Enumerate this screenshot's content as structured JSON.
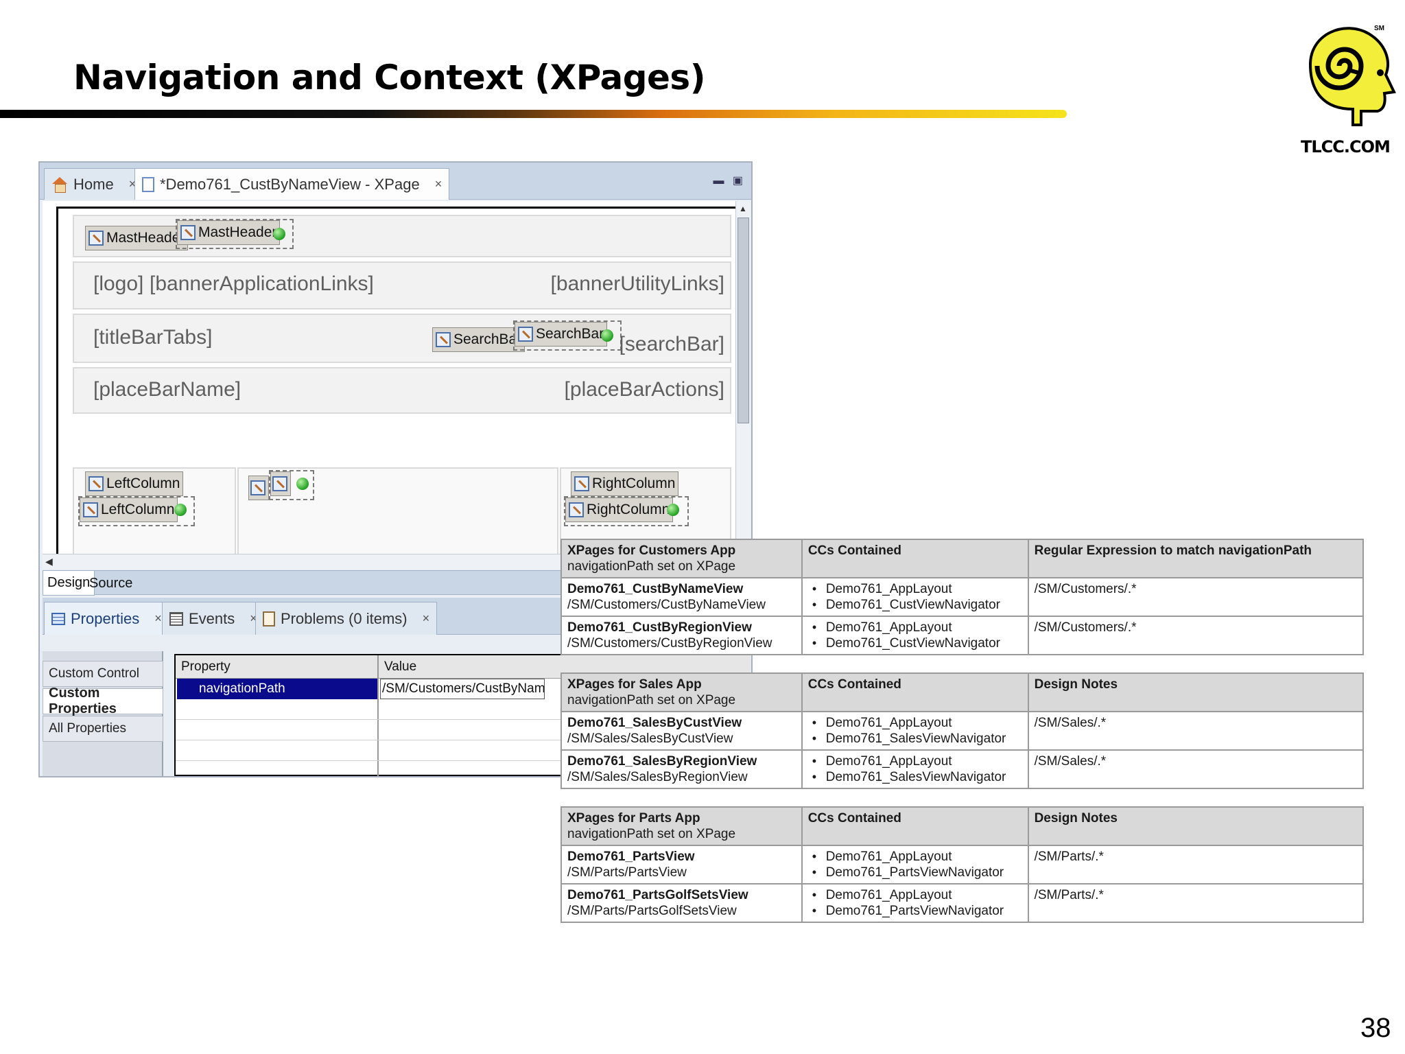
{
  "slide": {
    "title": "Navigation and Context (XPages)",
    "page_number": "38"
  },
  "logo": {
    "text": "TLCC.COM",
    "sm": "SM",
    "icon": "tlcc-spiral-head-icon"
  },
  "ide": {
    "editor_tabs": [
      {
        "label": "Home",
        "icon": "home-icon"
      },
      {
        "label": "*Demo761_CustByNameView - XPage",
        "icon": "xpage-icon"
      }
    ],
    "close_glyph": "×",
    "controls": {
      "mastheader_ref": "MastHeader",
      "mastheader_inst": "MastHeader",
      "searchbar_ref": "SearchBar",
      "searchbar_inst": "SearchBar",
      "leftcol_ref": "LeftColumn",
      "leftcol_inst": "LeftColumn",
      "rightcol_ref": "RightColumn",
      "rightcol_inst": "RightColumn"
    },
    "placeholders": {
      "logo": "[logo]",
      "banner_app_links": "[bannerApplicationLinks]",
      "banner_utility_links": "[bannerUtilityLinks]",
      "title_bar_tabs": "[titleBarTabs]",
      "search_bar": "[searchBar]",
      "place_bar_name": "[placeBarName]",
      "place_bar_actions": "[placeBarActions]"
    },
    "design_tabs": [
      "Design",
      "Source"
    ],
    "view_tabs": [
      {
        "label": "Properties",
        "icon": "properties-grid-icon"
      },
      {
        "label": "Events",
        "icon": "events-icon"
      },
      {
        "label": "Problems (0 items)",
        "icon": "problems-icon"
      }
    ],
    "side_nav": [
      "Custom Control",
      "Custom Properties",
      "All Properties"
    ],
    "prop_table": {
      "col_property": "Property",
      "col_value": "Value",
      "selected_property": "navigationPath",
      "selected_value": "/SM/Customers/CustByNameView"
    }
  },
  "tables": [
    {
      "headers": {
        "col1_title": "XPages for Customers App",
        "col1_sub": "navigationPath set on XPage",
        "col2": "CCs Contained",
        "col3": "Regular Expression to match navigationPath"
      },
      "rows": [
        {
          "name": "Demo761_CustByNameView",
          "path": "/SM/Customers/CustByNameView",
          "ccs": [
            "Demo761_AppLayout",
            "Demo761_CustViewNavigator"
          ],
          "regex": "/SM/Customers/.*"
        },
        {
          "name": "Demo761_CustByRegionView",
          "path": "/SM/Customers/CustByRegionView",
          "ccs": [
            "Demo761_AppLayout",
            "Demo761_CustViewNavigator"
          ],
          "regex": "/SM/Customers/.*"
        }
      ]
    },
    {
      "headers": {
        "col1_title": "XPages for Sales App",
        "col1_sub": "navigationPath set on XPage",
        "col2": "CCs Contained",
        "col3": "Design Notes"
      },
      "rows": [
        {
          "name": "Demo761_SalesByCustView",
          "path": "/SM/Sales/SalesByCustView",
          "ccs": [
            "Demo761_AppLayout",
            "Demo761_SalesViewNavigator"
          ],
          "regex": "/SM/Sales/.*"
        },
        {
          "name": "Demo761_SalesByRegionView",
          "path": "/SM/Sales/SalesByRegionView",
          "ccs": [
            "Demo761_AppLayout",
            "Demo761_SalesViewNavigator"
          ],
          "regex": "/SM/Sales/.*"
        }
      ]
    },
    {
      "headers": {
        "col1_title": "XPages for Parts App",
        "col1_sub": "navigationPath set on XPage",
        "col2": "CCs Contained",
        "col3": "Design Notes"
      },
      "rows": [
        {
          "name": "Demo761_PartsView",
          "path": "/SM/Parts/PartsView",
          "ccs": [
            "Demo761_AppLayout",
            "Demo761_PartsViewNavigator"
          ],
          "regex": "/SM/Parts/.*"
        },
        {
          "name": "Demo761_PartsGolfSetsView",
          "path": "/SM/Parts/PartsGolfSetsView",
          "ccs": [
            "Demo761_AppLayout",
            "Demo761_PartsViewNavigator"
          ],
          "regex": "/SM/Parts/.*"
        }
      ]
    }
  ]
}
